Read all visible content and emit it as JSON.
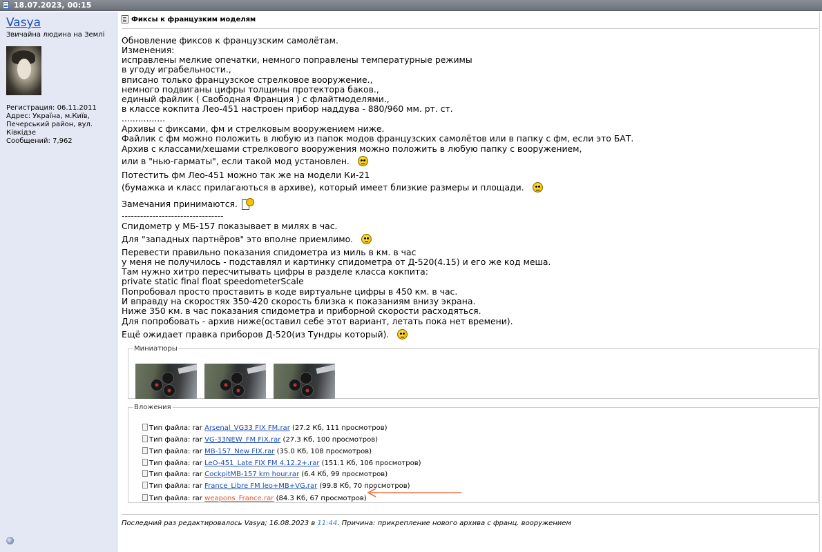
{
  "header": {
    "date": "18.07.2023, 00:15"
  },
  "user": {
    "name": "Vasya",
    "title": "Звичайна людина на Землі",
    "info": [
      "Регистрация: 06.11.2011",
      "Адрес: Україна, м.Київ,",
      "Печерський район, вул.",
      "Ківкідзе",
      "Сообщений: 7,962"
    ]
  },
  "post": {
    "title": "Фиксы к французким моделям",
    "lines": [
      "Обновление фиксов к французским самолётам.",
      "Изменения:",
      "исправлены мелкие опечатки, немного поправлены температурные режимы",
      "в угоду играбельности.,",
      "вписано только французское стрелковое вооружение.,",
      "немного подвиганы цифры толщины протектора баков.,",
      "единый файлик ( Свободная Франция ) с флайтмоделями.,",
      "в классе кокпита Лео-451 настроен прибор наддува - 880/960 мм. рт. ст.",
      "................",
      "Архивы с фиксами, фм и стрелковым вооружением ниже.",
      "Файлик с фм можно положить в любую из папок модов французских самолётов или в папку с фм, если это БАТ.",
      "Архив с классами/хешами стрелкового вооружения можно положить в любую папку с вооружением,",
      "или в \"нью-гарматы\", если такой мод установлен.",
      "Потестить фм Лео-451 можно так же на модели Ки-21",
      "(бумажка и класс прилагаються в архиве), который имеет близкие размеры и площади.",
      "Замечания принимаются.",
      "---------------------------------",
      "Спидометр у МБ-157 показывает в милях в час.",
      "Для \"западных партнёров\" это вполне приемлимо.",
      "Перевести правильно показания спидометра из миль в км. в час",
      "у меня не получилось - подставлял и картинку спидометра от Д-520(4.15) и его же код меша.",
      "Там нужно хитро пересчитывать цифры в разделе класса кокпита:",
      "private static final float speedometerScale",
      "Попробовал просто проставить в коде виртуальне цифры в 450 км. в час.",
      "И вправду на скоростях 350-420 скорость близка к показаниям внизу экрана.",
      "Ниже 350 км. в час показания спидометра и приборной скорости расходяться.",
      "Для попробовать - архив ниже(оставил себе этот вариант, летать пока нет времени).",
      "Ещё ожидает правка приборов Д-520(из Тундры который)."
    ]
  },
  "thumbnails": {
    "legend": "Миниатюры"
  },
  "attachments": {
    "legend": "Вложения",
    "type_label": "Тип файла: rar",
    "items": [
      {
        "name": "Arsenal_VG33 FIX FM.rar",
        "meta": "(27.2 Кб, 111 просмотров)"
      },
      {
        "name": "VG-33NEW_FM FIX.rar",
        "meta": "(27.3 Кб, 100 просмотров)"
      },
      {
        "name": "MB-157_New FIX.rar",
        "meta": "(35.0 Кб, 108 просмотров)"
      },
      {
        "name": "LeO-451_Late FIX FM 4.12.2+.rar",
        "meta": "(151.1 Кб, 106 просмотров)"
      },
      {
        "name": "CockpitMB-157 km hour.rar",
        "meta": "(6.4 Кб, 99 просмотров)"
      },
      {
        "name": "France_Libre FM leo+MB+VG.rar",
        "meta": "(99.8 Кб, 70 просмотров)"
      },
      {
        "name": "weapons_France.rar",
        "meta": "(84.3 Кб, 67 просмотров)"
      }
    ],
    "highlight_color": "#e8744a"
  },
  "footer": {
    "prefix": "Последний раз редактировалось Vasya; 16.08.2023 в ",
    "time": "11:44",
    "suffix": ". Причина: прикрепление нового архива с франц. вооружением"
  }
}
